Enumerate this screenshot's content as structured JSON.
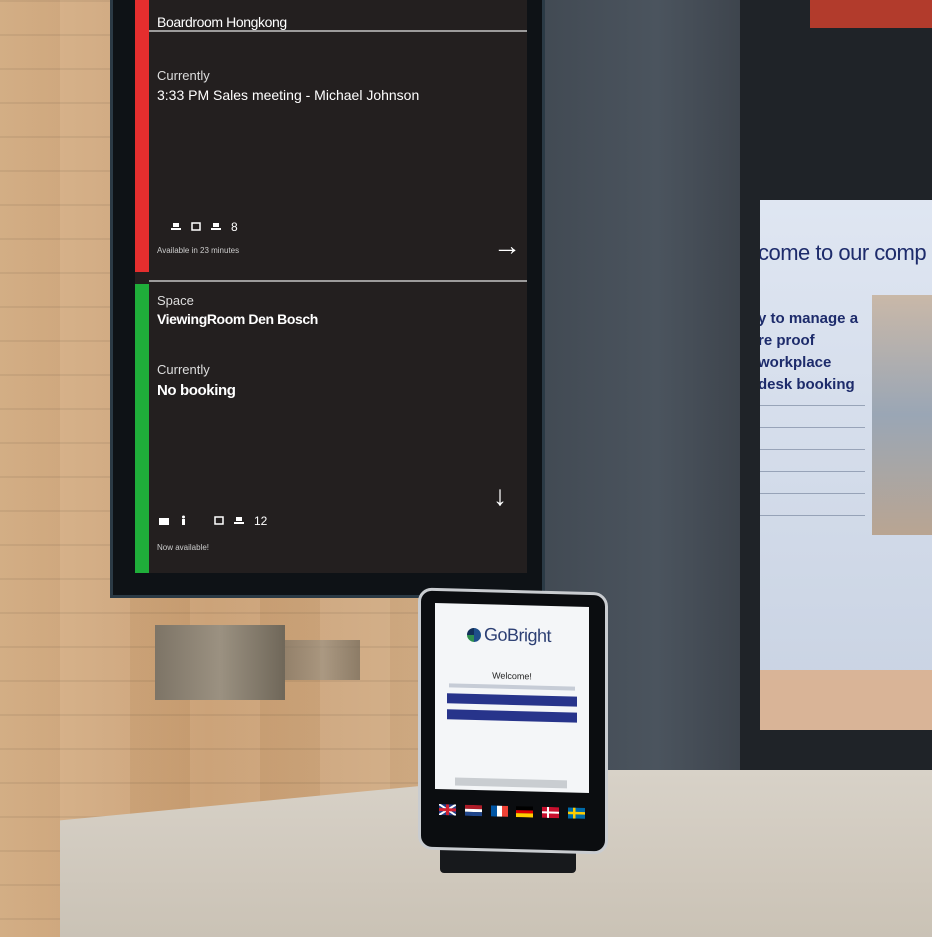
{
  "signage": {
    "room1": {
      "name": "Boardroom Hongkong",
      "current_label": "Currently",
      "current_booking": "3:33 PM Sales meeting - Michael Johnson",
      "capacity": "8",
      "status_text": "Available in 23 minutes",
      "status_color": "#e52e2e"
    },
    "room2": {
      "space_label": "Space",
      "name": "ViewingRoom Den Bosch",
      "current_label": "Currently",
      "current_booking": "No booking",
      "capacity": "12",
      "status_text": "Now available!",
      "status_color": "#1fae3a"
    }
  },
  "tablet": {
    "brand": "GoBright",
    "welcome": "Welcome!",
    "languages": [
      "uk-flag-icon",
      "nl-flag-icon",
      "fr-flag-icon",
      "de-flag-icon",
      "dk-flag-icon",
      "se-flag-icon"
    ]
  },
  "background_screen": {
    "title": "come to our comp",
    "heading": "y to manage a re proof workplace desk booking"
  },
  "colors": {
    "brand_blue": "#27348b",
    "wall": "#d8b38a",
    "cabinet": "#434b54"
  }
}
